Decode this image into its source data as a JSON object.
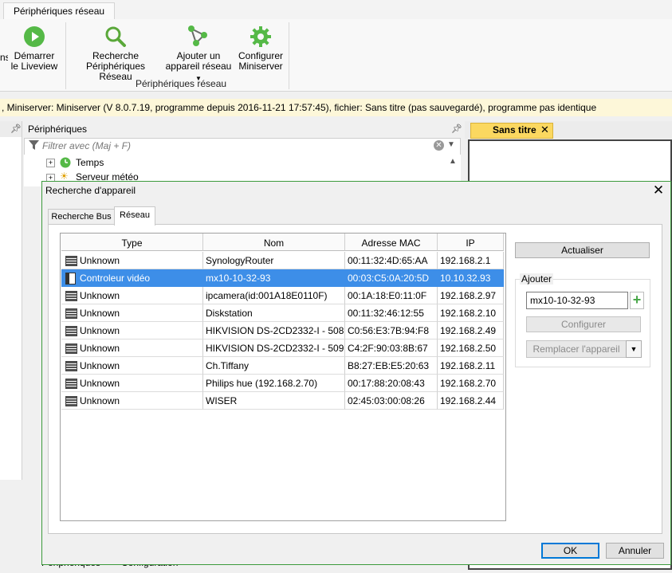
{
  "ribbon": {
    "tab_label": "Périphériques réseau",
    "left_partial": "ns",
    "start_liveview": {
      "line1": "Démarrer",
      "line2": "le Liveview"
    },
    "search_devices": {
      "line1": "Recherche",
      "line2": "Périphériques Réseau"
    },
    "add_device": {
      "line1": "Ajouter un",
      "line2": "appareil réseau"
    },
    "configure": {
      "line1": "Configurer",
      "line2": "Miniserver"
    },
    "group_label": "Périphériques réseau"
  },
  "status_bar": "Miniserver: Miniserver (V 8.0.7.19, programme depuis 2016-11-21 17:57:45), fichier: Sans titre (pas sauvegardé), programme pas identique",
  "periph_pane": {
    "title": "Périphériques",
    "filter_placeholder": "Filtrer avec (Maj + F)",
    "tree": [
      "Temps",
      "Serveur météo"
    ]
  },
  "doc_tab": "Sans titre",
  "bottom_tabs": [
    "Périphériques",
    "Configuration"
  ],
  "dialog": {
    "title": "Recherche d'appareil",
    "tabs": [
      "Recherche Bus",
      "Réseau"
    ],
    "columns": [
      "Type",
      "Nom",
      "Adresse MAC",
      "IP"
    ],
    "rows": [
      {
        "type": "Unknown",
        "name": "SynologyRouter",
        "mac": "00:11:32:4D:65:AA",
        "ip": "192.168.2.1",
        "selected": false
      },
      {
        "type": "Controleur vidéo",
        "name": "mx10-10-32-93",
        "mac": "00:03:C5:0A:20:5D",
        "ip": "10.10.32.93",
        "selected": true
      },
      {
        "type": "Unknown",
        "name": "ipcamera(id:001A18E0110F)",
        "mac": "00:1A:18:E0:11:0F",
        "ip": "192.168.2.97",
        "selected": false
      },
      {
        "type": "Unknown",
        "name": "Diskstation",
        "mac": "00:11:32:46:12:55",
        "ip": "192.168.2.10",
        "selected": false
      },
      {
        "type": "Unknown",
        "name": "HIKVISION DS-2CD2332-I - 508...",
        "mac": "C0:56:E3:7B:94:F8",
        "ip": "192.168.2.49",
        "selected": false
      },
      {
        "type": "Unknown",
        "name": "HIKVISION DS-2CD2332-I - 509...",
        "mac": "C4:2F:90:03:8B:67",
        "ip": "192.168.2.50",
        "selected": false
      },
      {
        "type": "Unknown",
        "name": "Ch.Tiffany",
        "mac": "B8:27:EB:E5:20:63",
        "ip": "192.168.2.11",
        "selected": false
      },
      {
        "type": "Unknown",
        "name": "Philips hue (192.168.2.70)",
        "mac": "00:17:88:20:08:43",
        "ip": "192.168.2.70",
        "selected": false
      },
      {
        "type": "Unknown",
        "name": "WISER",
        "mac": "02:45:03:00:08:26",
        "ip": "192.168.2.44",
        "selected": false
      }
    ],
    "refresh_label": "Actualiser",
    "add_group_label": "Ajouter",
    "name_value": "mx10-10-32-93",
    "configure_label": "Configurer",
    "replace_label": "Remplacer l'appareil",
    "ok_label": "OK",
    "cancel_label": "Annuler"
  },
  "colors": {
    "selection": "#3d8ee8",
    "status_bg": "#fdf7d9",
    "doc_tab": "#fbd860",
    "accent_green": "#4aa84a"
  }
}
